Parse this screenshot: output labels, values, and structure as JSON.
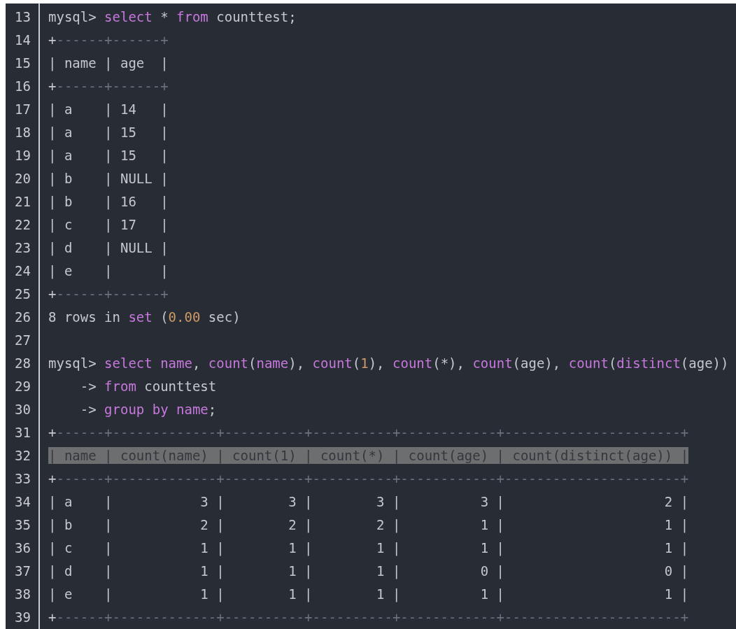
{
  "code_block": {
    "lines": [
      {
        "number": "13",
        "segments": [
          {
            "text": "mysql> ",
            "kind": "plain"
          },
          {
            "text": "select",
            "kind": "keyword"
          },
          {
            "text": " * ",
            "kind": "plain"
          },
          {
            "text": "from",
            "kind": "keyword"
          },
          {
            "text": " counttest;",
            "kind": "plain"
          }
        ]
      },
      {
        "number": "14",
        "segments": [
          {
            "text": "+",
            "kind": "plain"
          },
          {
            "text": "------+------+",
            "kind": "border"
          }
        ]
      },
      {
        "number": "15",
        "segments": [
          {
            "text": "| name | age  |",
            "kind": "plain"
          }
        ]
      },
      {
        "number": "16",
        "segments": [
          {
            "text": "+",
            "kind": "plain"
          },
          {
            "text": "------+------+",
            "kind": "border"
          }
        ]
      },
      {
        "number": "17",
        "segments": [
          {
            "text": "| a    | 14   |",
            "kind": "plain"
          }
        ]
      },
      {
        "number": "18",
        "segments": [
          {
            "text": "| a    | 15   |",
            "kind": "plain"
          }
        ]
      },
      {
        "number": "19",
        "segments": [
          {
            "text": "| a    | 15   |",
            "kind": "plain"
          }
        ]
      },
      {
        "number": "20",
        "segments": [
          {
            "text": "| b    | NULL |",
            "kind": "plain"
          }
        ]
      },
      {
        "number": "21",
        "segments": [
          {
            "text": "| b    | 16   |",
            "kind": "plain"
          }
        ]
      },
      {
        "number": "22",
        "segments": [
          {
            "text": "| c    | 17   |",
            "kind": "plain"
          }
        ]
      },
      {
        "number": "23",
        "segments": [
          {
            "text": "| d    | NULL |",
            "kind": "plain"
          }
        ]
      },
      {
        "number": "24",
        "segments": [
          {
            "text": "| e    |      |",
            "kind": "plain"
          }
        ]
      },
      {
        "number": "25",
        "segments": [
          {
            "text": "+",
            "kind": "plain"
          },
          {
            "text": "------+------+",
            "kind": "border"
          }
        ]
      },
      {
        "number": "26",
        "segments": [
          {
            "text": "8 rows in ",
            "kind": "plain"
          },
          {
            "text": "set",
            "kind": "keyword"
          },
          {
            "text": " (",
            "kind": "plain"
          },
          {
            "text": "0.00",
            "kind": "number"
          },
          {
            "text": " sec)",
            "kind": "plain"
          }
        ]
      },
      {
        "number": "27"
      },
      {
        "number": "28",
        "segments": [
          {
            "text": "mysql> ",
            "kind": "plain"
          },
          {
            "text": "select name",
            "kind": "keyword"
          },
          {
            "text": ", ",
            "kind": "plain"
          },
          {
            "text": "count",
            "kind": "keyword"
          },
          {
            "text": "(",
            "kind": "plain"
          },
          {
            "text": "name",
            "kind": "keyword"
          },
          {
            "text": "), ",
            "kind": "plain"
          },
          {
            "text": "count",
            "kind": "keyword"
          },
          {
            "text": "(",
            "kind": "plain"
          },
          {
            "text": "1",
            "kind": "number"
          },
          {
            "text": "), ",
            "kind": "plain"
          },
          {
            "text": "count",
            "kind": "keyword"
          },
          {
            "text": "(*), ",
            "kind": "plain"
          },
          {
            "text": "count",
            "kind": "keyword"
          },
          {
            "text": "(age), ",
            "kind": "plain"
          },
          {
            "text": "count",
            "kind": "keyword"
          },
          {
            "text": "(",
            "kind": "plain"
          },
          {
            "text": "distinct",
            "kind": "keyword"
          },
          {
            "text": "(age))",
            "kind": "plain"
          }
        ]
      },
      {
        "number": "29",
        "segments": [
          {
            "text": "    -> ",
            "kind": "plain"
          },
          {
            "text": "from",
            "kind": "keyword"
          },
          {
            "text": " counttest",
            "kind": "plain"
          }
        ]
      },
      {
        "number": "30",
        "segments": [
          {
            "text": "    -> ",
            "kind": "plain"
          },
          {
            "text": "group by name",
            "kind": "keyword"
          },
          {
            "text": ";",
            "kind": "plain"
          }
        ]
      },
      {
        "number": "31",
        "segments": [
          {
            "text": "+",
            "kind": "plain"
          },
          {
            "text": "------+-------------+----------+----------+------------+----------------------+",
            "kind": "border"
          }
        ]
      },
      {
        "number": "32",
        "highlighted": true,
        "segments": [
          {
            "text": "| name | count(name) | count(1) | count(*) | count(age) | count(distinct(age)) |",
            "kind": "plain"
          }
        ]
      },
      {
        "number": "33",
        "segments": [
          {
            "text": "+",
            "kind": "plain"
          },
          {
            "text": "------+-------------+----------+----------+------------+----------------------+",
            "kind": "border"
          }
        ]
      },
      {
        "number": "34",
        "segments": [
          {
            "text": "| a    |           3 |        3 |        3 |          3 |                    2 |",
            "kind": "plain"
          }
        ]
      },
      {
        "number": "35",
        "segments": [
          {
            "text": "| b    |           2 |        2 |        2 |          1 |                    1 |",
            "kind": "plain"
          }
        ]
      },
      {
        "number": "36",
        "segments": [
          {
            "text": "| c    |           1 |        1 |        1 |          1 |                    1 |",
            "kind": "plain"
          }
        ]
      },
      {
        "number": "37",
        "segments": [
          {
            "text": "| d    |           1 |        1 |        1 |          0 |                    0 |",
            "kind": "plain"
          }
        ]
      },
      {
        "number": "38",
        "segments": [
          {
            "text": "| e    |           1 |        1 |        1 |          1 |                    1 |",
            "kind": "plain"
          }
        ]
      },
      {
        "number": "39",
        "segments": [
          {
            "text": "+",
            "kind": "plain"
          },
          {
            "text": "------+-------------+----------+----------+------------+----------------------+",
            "kind": "border"
          }
        ]
      }
    ]
  }
}
